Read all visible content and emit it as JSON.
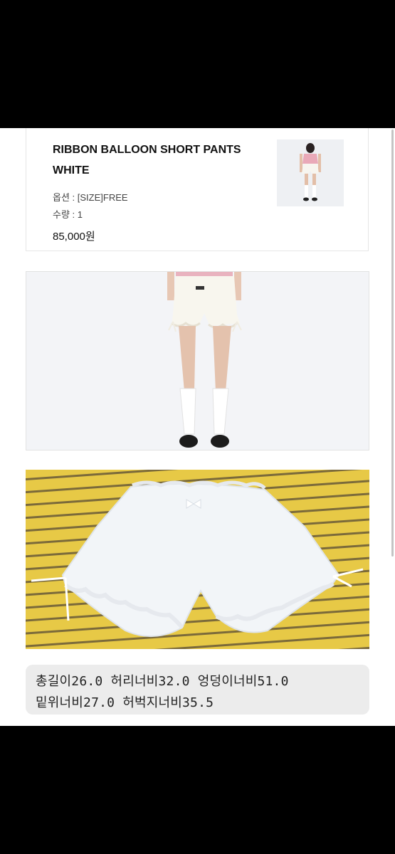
{
  "order": {
    "title_line1": "RIBBON BALLOON SHORT PANTS",
    "title_line2": "WHITE",
    "option": "옵션 : [SIZE]FREE",
    "quantity": "수량 : 1",
    "price": "85,000원"
  },
  "measurements": {
    "line1": "총길이26.0 허리너비32.0 엉덩이너비51.0",
    "line2": "밑위너비27.0 허벅지너비35.5"
  },
  "colors": {
    "page_bg": "#000000",
    "content_bg": "#ffffff",
    "stripe_yellow": "#e7c946",
    "stripe_brown": "#7b6a3a",
    "measure_bg": "#ececec"
  }
}
